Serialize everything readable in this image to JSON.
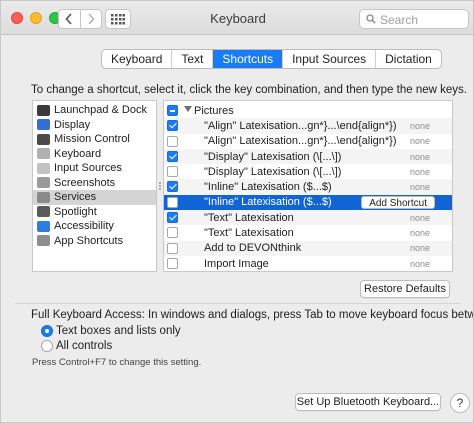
{
  "window": {
    "title": "Keyboard"
  },
  "search": {
    "placeholder": "Search"
  },
  "tabs": [
    {
      "label": "Keyboard",
      "active": false
    },
    {
      "label": "Text",
      "active": false
    },
    {
      "label": "Shortcuts",
      "active": true
    },
    {
      "label": "Input Sources",
      "active": false
    },
    {
      "label": "Dictation",
      "active": false
    }
  ],
  "instruction": "To change a shortcut, select it, click the key combination, and then type the new keys.",
  "categories": [
    {
      "label": "Launchpad & Dock",
      "icon": "launchpad-icon",
      "color": "#3b3b3b",
      "selected": false
    },
    {
      "label": "Display",
      "icon": "display-icon",
      "color": "#2f6fd6",
      "selected": false
    },
    {
      "label": "Mission Control",
      "icon": "mission-control-icon",
      "color": "#4a4a4a",
      "selected": false
    },
    {
      "label": "Keyboard",
      "icon": "keyboard-icon",
      "color": "#b0b0b0",
      "selected": false
    },
    {
      "label": "Input Sources",
      "icon": "input-sources-icon",
      "color": "#c2c2c2",
      "selected": false
    },
    {
      "label": "Screenshots",
      "icon": "screenshots-icon",
      "color": "#9a9a9a",
      "selected": false
    },
    {
      "label": "Services",
      "icon": "gear-icon",
      "color": "#8a8a8a",
      "selected": true
    },
    {
      "label": "Spotlight",
      "icon": "spotlight-icon",
      "color": "#5b5b5b",
      "selected": false
    },
    {
      "label": "Accessibility",
      "icon": "accessibility-icon",
      "color": "#2a7de1",
      "selected": false
    },
    {
      "label": "App Shortcuts",
      "icon": "app-shortcuts-icon",
      "color": "#8d8d8d",
      "selected": false
    }
  ],
  "shortcuts": [
    {
      "label": "Pictures",
      "group": true,
      "state": "mixed",
      "shortcut": ""
    },
    {
      "label": "\"Align\" Latexisation...gn*}...\\end{align*})",
      "state": "on",
      "shortcut": "none"
    },
    {
      "label": "\"Align\" Latexisation...gn*}...\\end{align*})",
      "state": "off",
      "shortcut": "none"
    },
    {
      "label": "\"Display\" Latexisation (\\[...\\])",
      "state": "on",
      "shortcut": "none"
    },
    {
      "label": "\"Display\" Latexisation (\\[...\\])",
      "state": "off",
      "shortcut": "none"
    },
    {
      "label": "\"Inline\" Latexisation ($...$)",
      "state": "on",
      "shortcut": "none"
    },
    {
      "label": "\"Inline\" Latexisation ($...$)",
      "state": "off",
      "shortcut": "Add Shortcut",
      "highlighted": true
    },
    {
      "label": "\"Text\" Latexisation",
      "state": "on",
      "shortcut": "none"
    },
    {
      "label": "\"Text\" Latexisation",
      "state": "off",
      "shortcut": "none"
    },
    {
      "label": "Add to DEVONthink",
      "state": "off",
      "shortcut": "none"
    },
    {
      "label": "Import Image",
      "state": "off",
      "shortcut": "none"
    }
  ],
  "restore_defaults": "Restore Defaults",
  "full_keyboard_access": "Full Keyboard Access: In windows and dialogs, press Tab to move keyboard focus between:",
  "focus_options": [
    {
      "label": "Text boxes and lists only",
      "selected": true
    },
    {
      "label": "All controls",
      "selected": false
    }
  ],
  "hint": "Press Control+F7 to change this setting.",
  "bluetooth_button": "Set Up Bluetooth Keyboard...",
  "help_label": "?",
  "colors": {
    "accent": "#1a7cf5",
    "selection": "#1164d6"
  }
}
